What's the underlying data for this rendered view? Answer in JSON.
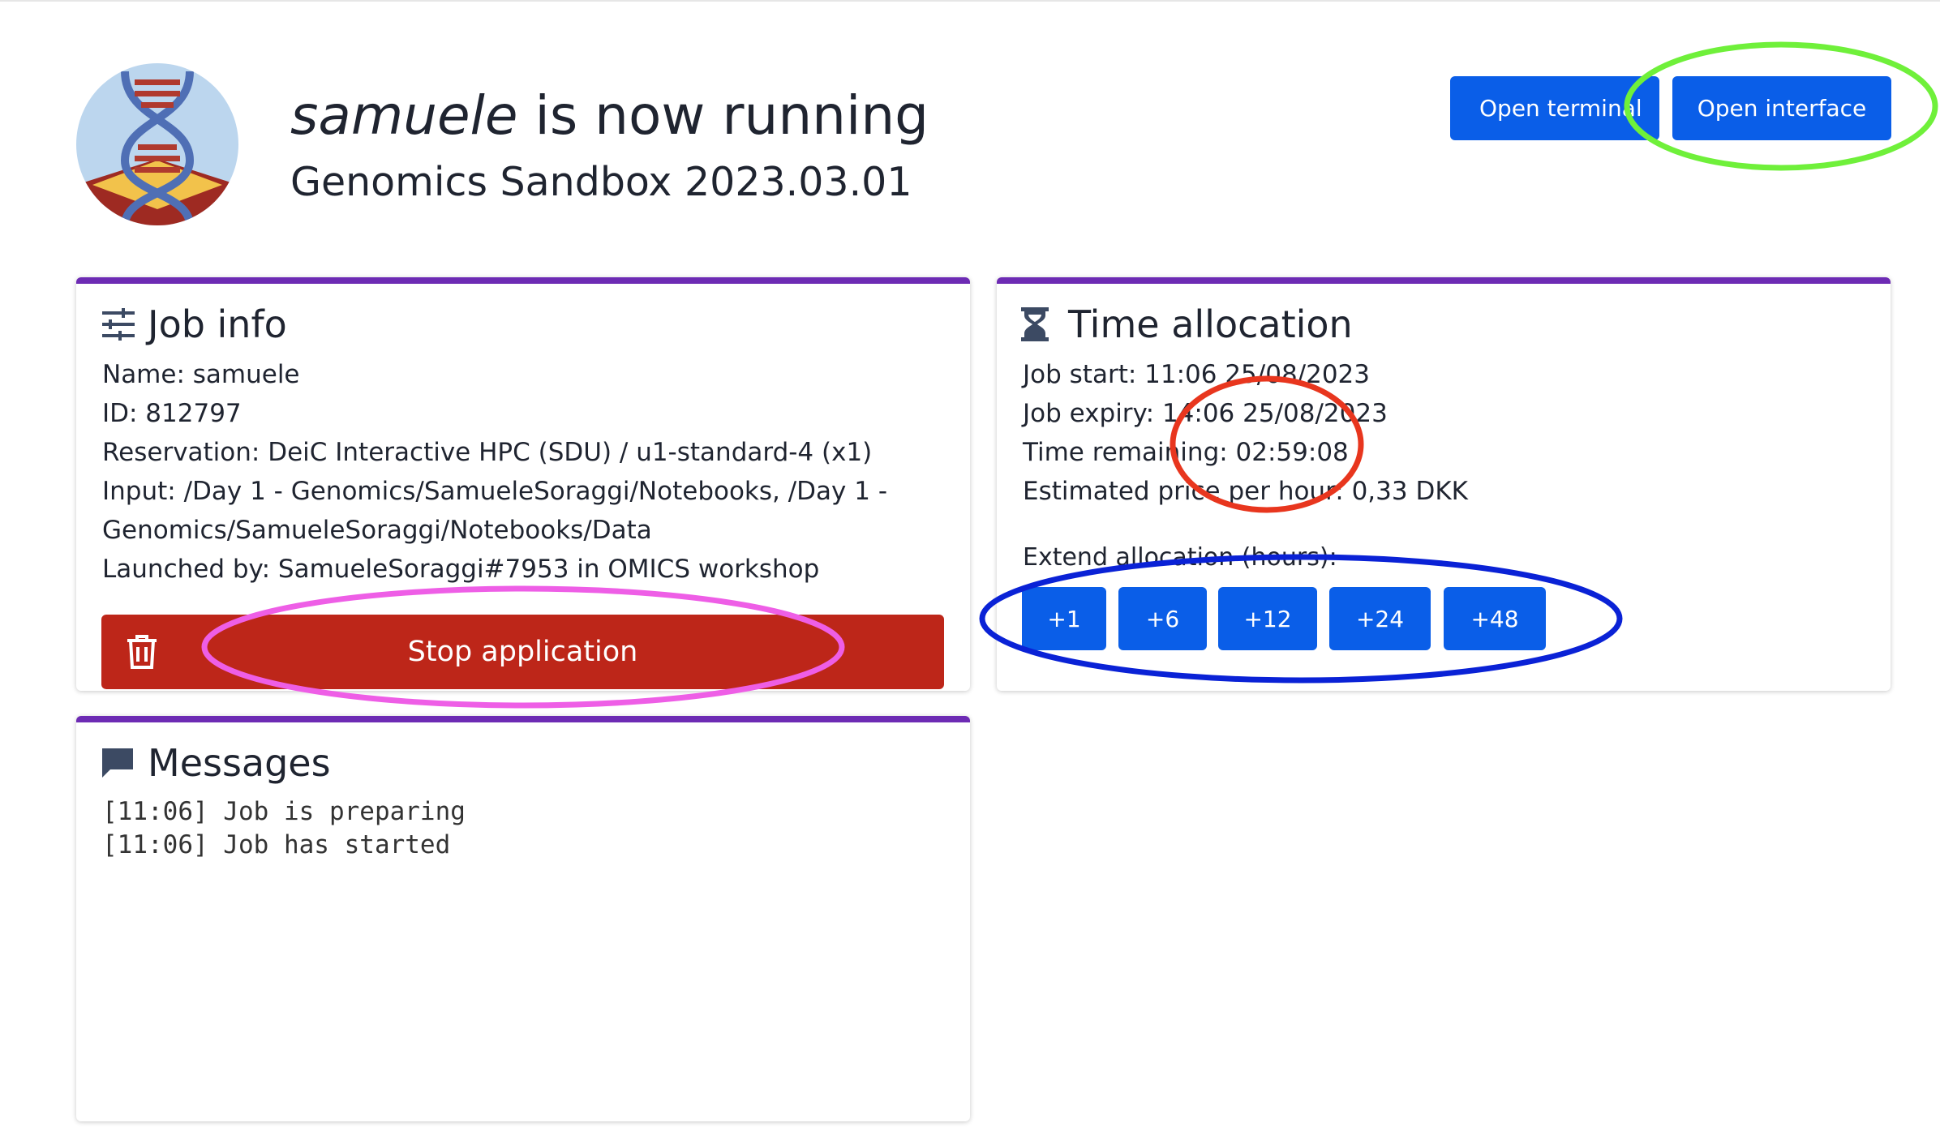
{
  "header": {
    "app_name": "samuele",
    "running_suffix": " is now running",
    "subtitle": "Genomics Sandbox 2023.03.01",
    "open_terminal_label": "Open terminal",
    "open_interface_label": "Open interface",
    "logo_icon": "dna-sandbox-logo"
  },
  "job_info": {
    "title": "Job info",
    "icon": "sliders-icon",
    "lines": [
      "Name: samuele",
      "ID: 812797",
      "Reservation: DeiC Interactive HPC (SDU) / u1-standard-4 (x1)",
      "Input: /Day 1 - Genomics/SamueleSoraggi/Notebooks, /Day 1 -",
      "Genomics/SamueleSoraggi/Notebooks/Data",
      "Launched by: SamueleSoraggi#7953 in OMICS workshop"
    ],
    "stop_label": "Stop application"
  },
  "time_allocation": {
    "title": "Time allocation",
    "icon": "hourglass-icon",
    "lines": [
      "Job start: 11:06 25/08/2023",
      "Job expiry: 14:06 25/08/2023",
      "Time remaining: 02:59:08",
      "Estimated price per hour: 0,33 DKK"
    ],
    "extend_label": "Extend allocation (hours):",
    "extend_buttons": [
      "+1",
      "+6",
      "+12",
      "+24",
      "+48"
    ]
  },
  "messages": {
    "title": "Messages",
    "icon": "chat-icon",
    "lines": [
      "[11:06] Job is preparing",
      "[11:06] Job has started"
    ]
  },
  "colors": {
    "primary": "#0a5ee8",
    "danger": "#bd2619",
    "card_accent": "#6d2bb4",
    "annotation_green": "#6ff03a",
    "annotation_red": "#e8361e",
    "annotation_blue": "#0a22d6",
    "annotation_magenta": "#ee5ee6"
  }
}
